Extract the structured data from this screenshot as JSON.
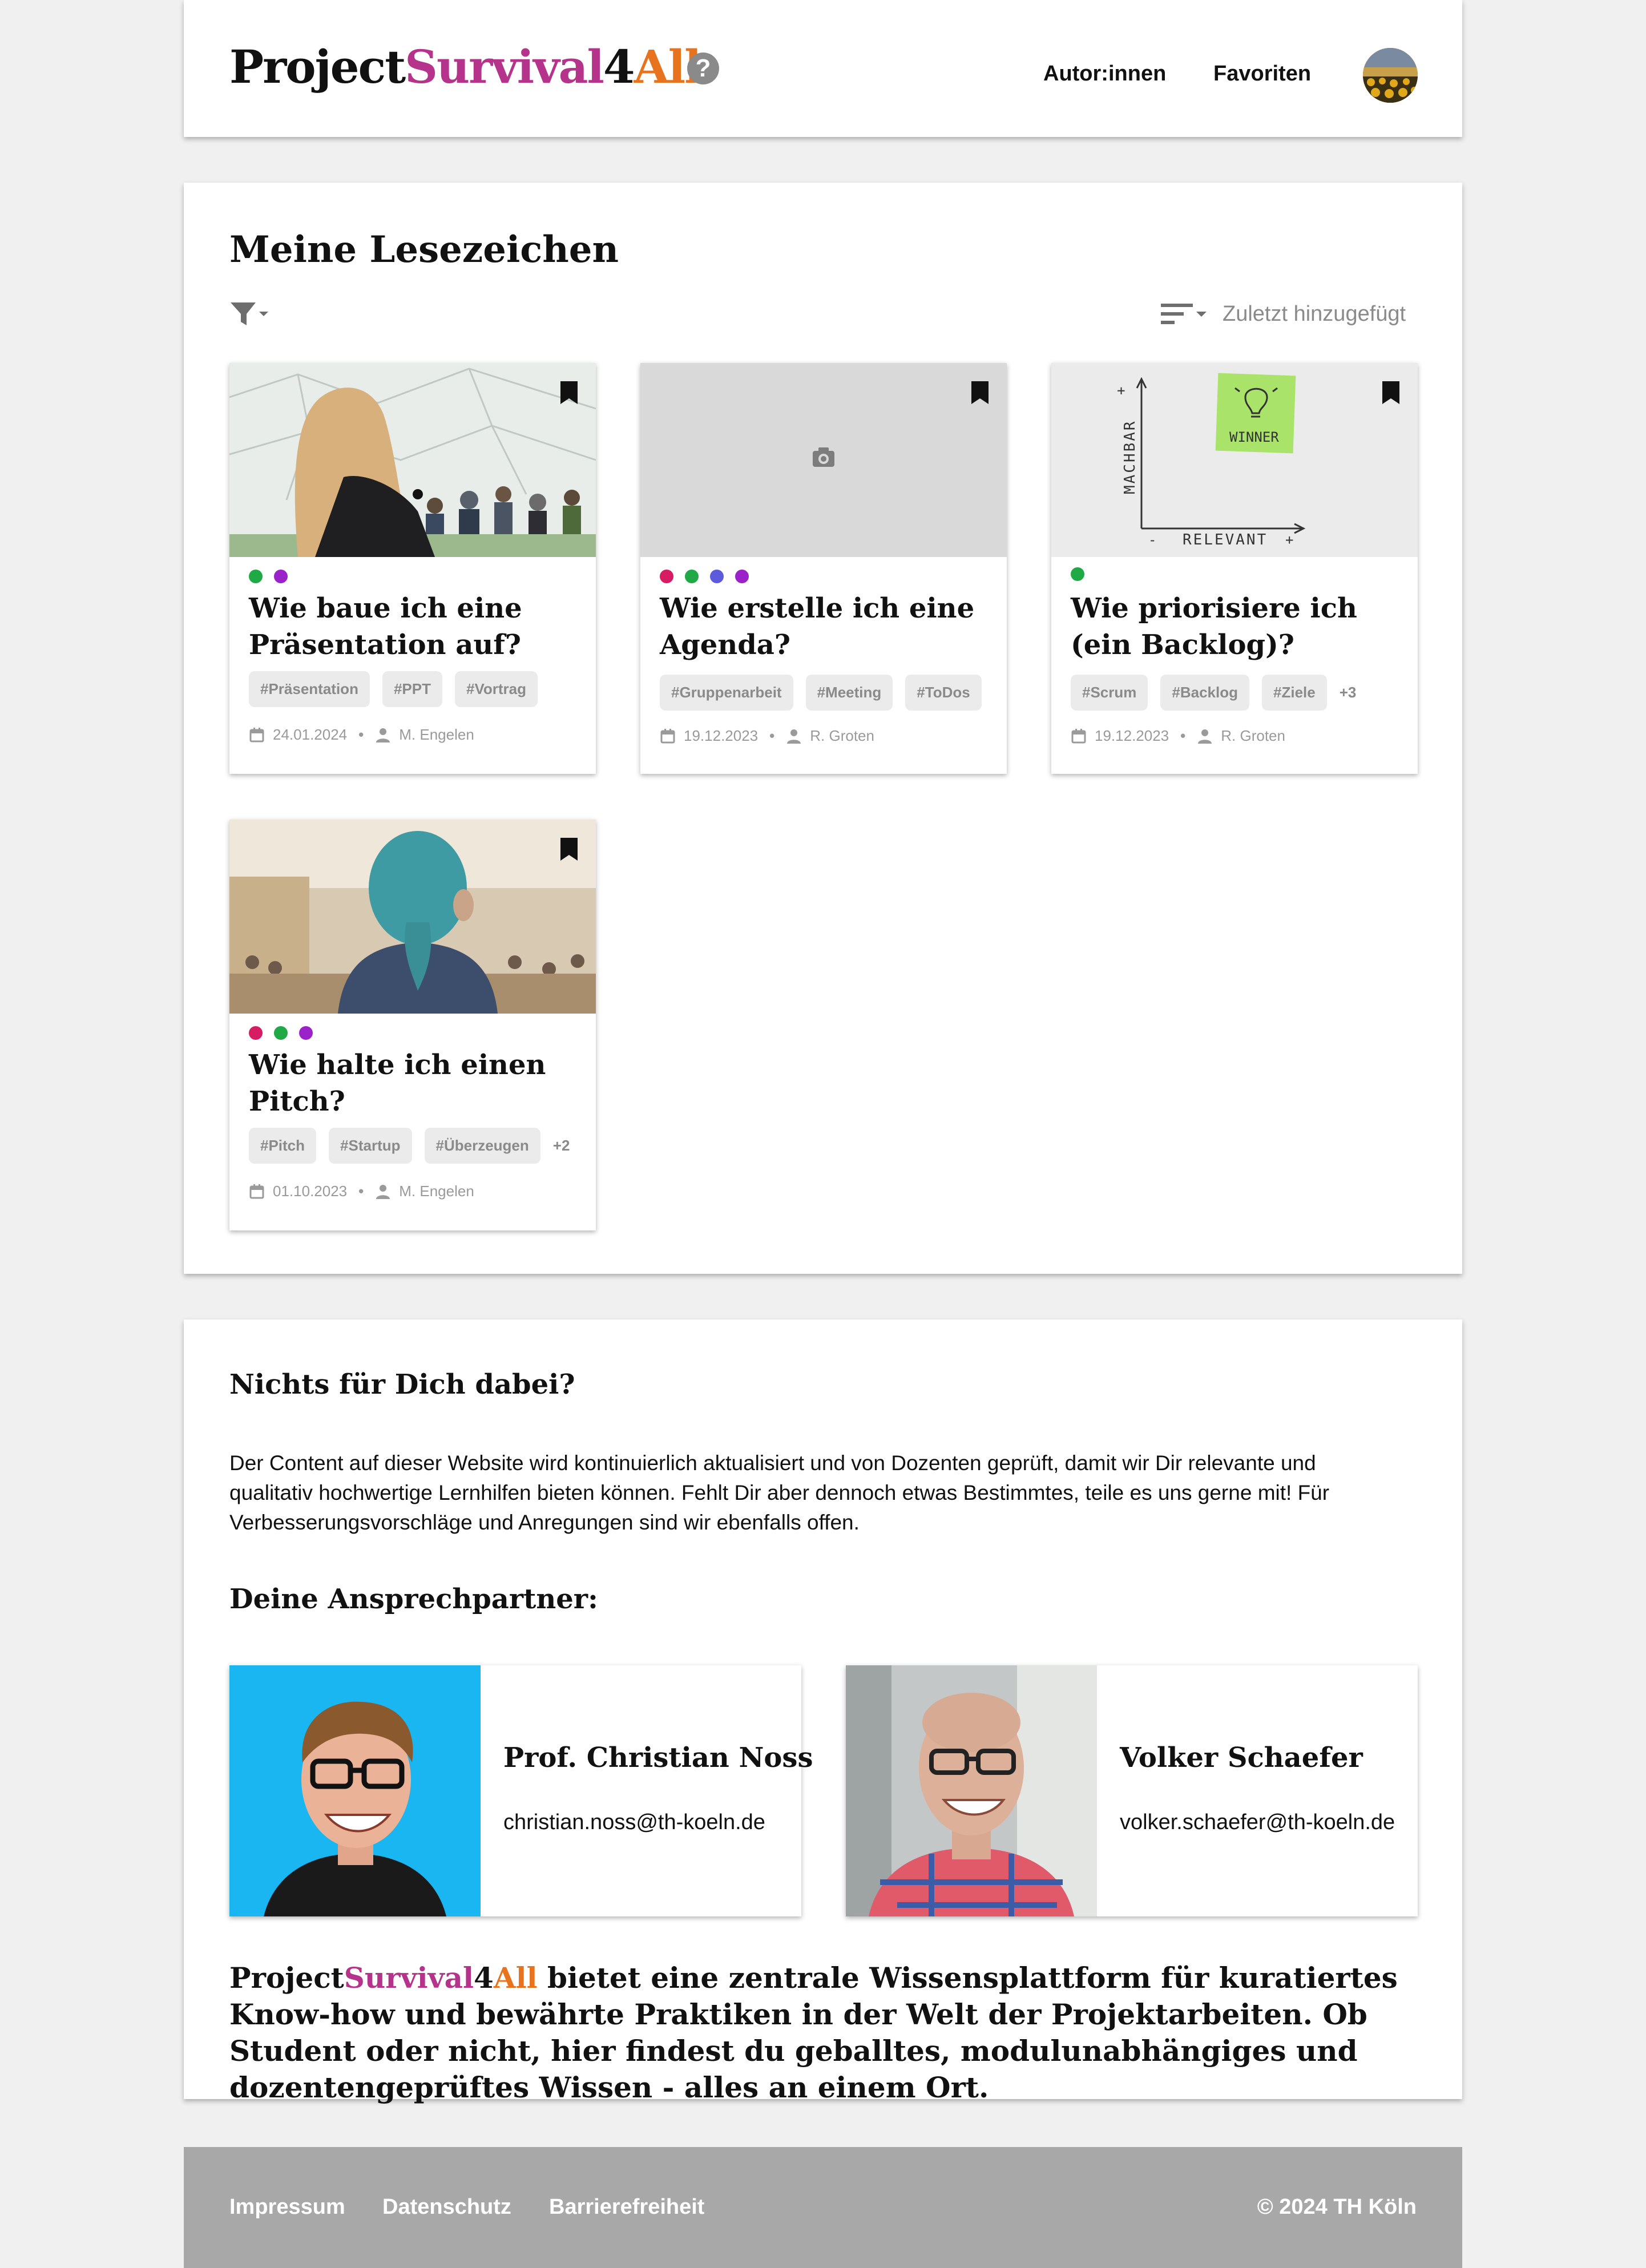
{
  "header": {
    "logo": {
      "part1": "Project",
      "part2": "Survival",
      "part3": "4",
      "part4": "All"
    },
    "help_glyph": "?",
    "nav": {
      "authors": "Autor:innen",
      "favorites": "Favoriten"
    }
  },
  "bookmarks": {
    "title": "Meine Lesezeichen",
    "sort_label": "Zuletzt hinzugefügt",
    "cards": [
      {
        "title": "Wie baue ich eine Präsentation auf?",
        "dots": [
          "#1faa46",
          "#9b22c9"
        ],
        "tags": [
          "#Präsentation",
          "#PPT",
          "#Vortrag"
        ],
        "more": "",
        "date": "24.01.2024",
        "author": "M. Engelen"
      },
      {
        "title": "Wie erstelle ich eine Agenda?",
        "dots": [
          "#d61c63",
          "#1faa46",
          "#5b5bdb",
          "#9b22c9"
        ],
        "tags": [
          "#Gruppenarbeit",
          "#Meeting",
          "#ToDos"
        ],
        "more": "",
        "date": "19.12.2023",
        "author": "R. Groten"
      },
      {
        "title": "Wie priorisiere ich (ein Backlog)?",
        "dots": [
          "#1faa46"
        ],
        "tags": [
          "#Scrum",
          "#Backlog",
          "#Ziele"
        ],
        "more": "+3",
        "date": "19.12.2023",
        "author": "R. Groten",
        "sketch": {
          "y_axis": "MACHBAR",
          "x_axis": "RELEVANT",
          "note": "WINNER",
          "plus": "+",
          "minus": "-"
        }
      },
      {
        "title": "Wie halte ich einen Pitch?",
        "dots": [
          "#d61c63",
          "#1faa46",
          "#9b22c9"
        ],
        "tags": [
          "#Pitch",
          "#Startup",
          "#Überzeugen"
        ],
        "more": "+2",
        "date": "01.10.2023",
        "author": "M. Engelen"
      }
    ]
  },
  "info": {
    "heading": "Nichts für Dich dabei?",
    "paragraph": "Der Content auf dieser Website wird kontinuierlich aktualisiert und von Dozenten geprüft, damit wir Dir relevante und qualitativ hochwertige Lernhilfen bieten können. Fehlt Dir aber dennoch etwas Bestimmtes, teile es uns gerne mit! Für Verbesserungsvorschläge und Anregungen sind wir ebenfalls offen.",
    "contacts_heading": "Deine Ansprechpartner:",
    "contacts": [
      {
        "name": "Prof. Christian Noss",
        "email": "christian.noss@th-koeln.de"
      },
      {
        "name": "Volker Schaefer",
        "email": "volker.schaefer@th-koeln.de"
      }
    ],
    "closing": {
      "logo1": "Project",
      "logo2": "Survival",
      "logo3": "4",
      "logo4": "All",
      "text": " bietet eine zentrale Wissensplattform für kuratiertes Know-how und bewährte Praktiken in der Welt der Projektarbeiten. Ob Student oder nicht, hier findest du geballtes, modulunabhängiges und dozentengeprüftes Wissen - alles an einem Ort."
    }
  },
  "footer": {
    "impressum": "Impressum",
    "datenschutz": "Datenschutz",
    "barrierefreiheit": "Barrierefreiheit",
    "copyright": "© 2024 TH Köln"
  },
  "colors": {
    "purple": "#b5338a",
    "orange": "#e8731e",
    "tag_bg": "#ebebeb",
    "footer_bg": "#a8a8a8"
  }
}
